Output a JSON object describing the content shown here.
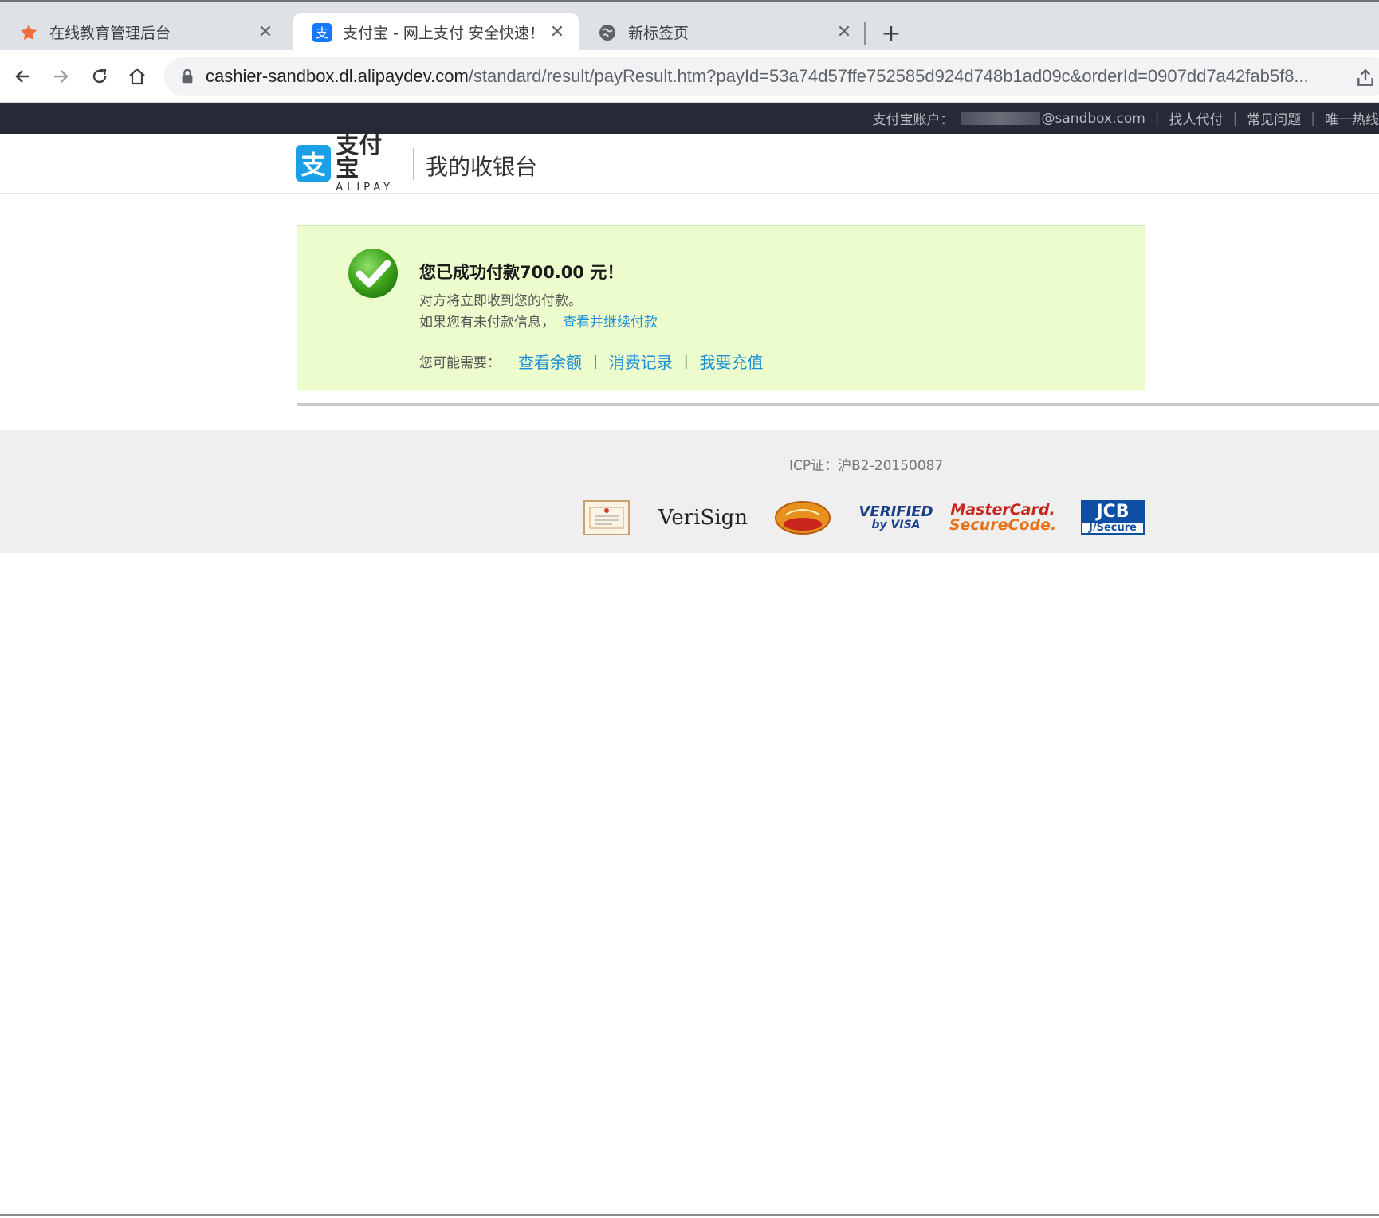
{
  "browser": {
    "tabs": [
      {
        "title": "在线教育管理后台",
        "icon": "flower-icon",
        "active": false
      },
      {
        "title": "支付宝 - 网上支付 安全快速！",
        "icon": "alipay-icon",
        "active": true
      },
      {
        "title": "新标签页",
        "icon": "globe-icon",
        "active": false
      }
    ],
    "new_tab": "+",
    "url_host": "cashier-sandbox.dl.alipaydev.com",
    "url_path": "/standard/result/payResult.htm?payId=53a74d57ffe752585d924d748b1ad09c&orderId=0907dd7a42fab5f8..."
  },
  "topbar": {
    "account_label": "支付宝账户：",
    "account_suffix": "@sandbox.com",
    "links": [
      "找人代付",
      "常见问题",
      "唯一热线"
    ]
  },
  "header": {
    "logo_cn": "支付宝",
    "logo_en": "ALIPAY",
    "logo_mark": "支",
    "title": "我的收银台"
  },
  "result": {
    "title": "您已成功付款700.00 元！",
    "subtitle": "对方将立即收到您的付款。",
    "unpaid_text": "如果您有未付款信息，",
    "unpaid_link": "查看并继续付款",
    "maybe_label": "您可能需要：",
    "maybe_links": [
      "查看余额",
      "消费记录",
      "我要充值"
    ],
    "separator": "|"
  },
  "footer": {
    "icp": "ICP证：沪B2-20150087",
    "badges": {
      "verisign": "VeriSign",
      "visa_top": "VERIFIED",
      "visa_bottom": "by VISA",
      "mc_top": "MasterCard.",
      "mc_bottom": "SecureCode.",
      "jcb_top": "JCB",
      "jcb_bottom": "J/Secure"
    }
  },
  "colors": {
    "topbar_bg": "#262a36",
    "success_bg": "#ecfccd",
    "link": "#1a8fd8",
    "alipay_blue": "#1aa0e6"
  }
}
